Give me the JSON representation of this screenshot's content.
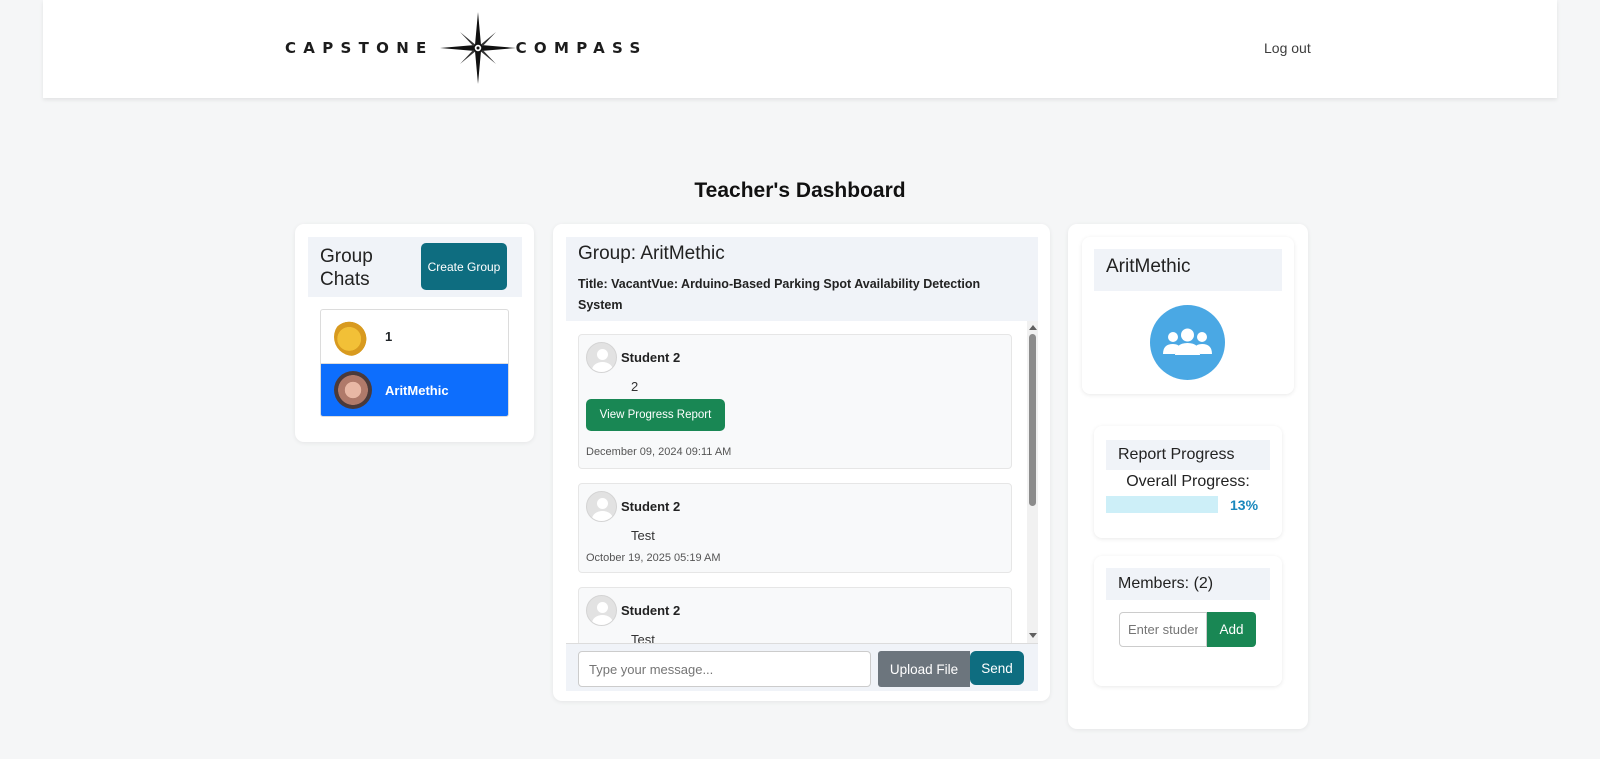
{
  "brand": {
    "left_word": "CAPSTONE",
    "right_word": "COMPASS",
    "logo_icon": "compass-star-icon"
  },
  "nav": {
    "logout_label": "Log out"
  },
  "page": {
    "title": "Teacher's Dashboard"
  },
  "group_chats": {
    "title": "Group Chats",
    "create_button": "Create Group",
    "items": [
      {
        "name": "1",
        "active": false
      },
      {
        "name": "AritMethic",
        "active": true
      }
    ]
  },
  "chat": {
    "group_label": "Group: AritMethic",
    "project_title": "Title: VacantVue: Arduino-Based Parking Spot Availability Detection System",
    "messages": [
      {
        "sender": "Student 2",
        "text": "2",
        "button": "View Progress Report",
        "time": "December 09, 2024 09:11 AM"
      },
      {
        "sender": "Student 2",
        "text": "Test",
        "time": "October 19, 2025 05:19 AM"
      },
      {
        "sender": "Student 2",
        "text": "Test",
        "time": ""
      }
    ],
    "input_placeholder": "Type your message...",
    "upload_label": "Upload File",
    "send_label": "Send"
  },
  "group_info": {
    "name": "AritMethic",
    "icon": "users-group-icon",
    "icon_color": "#4aa8e4"
  },
  "report_progress": {
    "title": "Report Progress",
    "overall_label": "Overall Progress:",
    "percent_text": "13%",
    "percent_value": 13
  },
  "members": {
    "title": "Members: (2)",
    "input_placeholder": "Enter student",
    "add_label": "Add"
  },
  "colors": {
    "teal": "#0e6d80",
    "green": "#198754",
    "active_blue": "#0d6efd",
    "gray_button": "#6c757d",
    "progress_text": "#1a88bd"
  }
}
